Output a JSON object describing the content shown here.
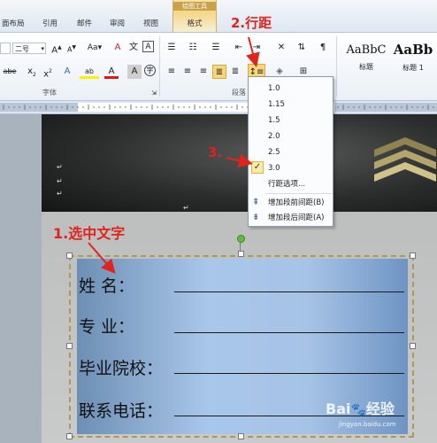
{
  "tabs": {
    "layout": "面布局",
    "references": "引用",
    "mailings": "邮件",
    "review": "审阅",
    "view": "视图",
    "ctx_group": "绘图工具",
    "format": "格式"
  },
  "ribbon": {
    "font_size": "二号",
    "font_grow": "A",
    "font_shrink": "A",
    "change_case": "Aa",
    "clear_format": "A",
    "char_border": "A",
    "bold_hint": "abe",
    "subscript": "x",
    "superscript": "x",
    "text_effects": "A",
    "highlight": "ab",
    "font_color": "A",
    "char_shade": "A",
    "font_group_label": "字体",
    "paragraph_group_label": "段落",
    "style_normal_sample": "AaBbC",
    "style_normal_label": "标题",
    "style_h1_sample": "AaBb",
    "style_h1_label": "标题 1"
  },
  "annotations": {
    "step1": "1.选中文字",
    "step2": "2.行距",
    "step3": "3."
  },
  "line_spacing_menu": {
    "items": [
      "1.0",
      "1.15",
      "1.5",
      "2.0",
      "2.5",
      "3.0"
    ],
    "selected": "3.0",
    "options_label": "行距选项...",
    "add_before": "增加段前间距(B)",
    "add_after": "增加段后间距(A)"
  },
  "form": {
    "name_label": "姓      名：",
    "major_label": "专      业：",
    "school_label": "毕业院校：",
    "phone_label": "联系电话："
  },
  "watermark": {
    "brand": "Bai",
    "brand2": "经验",
    "url": "jingyan.baidu.com"
  },
  "colors": {
    "annotation": "#e0241c",
    "menu_check": "#fde9a8",
    "form_blue": "#a9c7ea"
  }
}
